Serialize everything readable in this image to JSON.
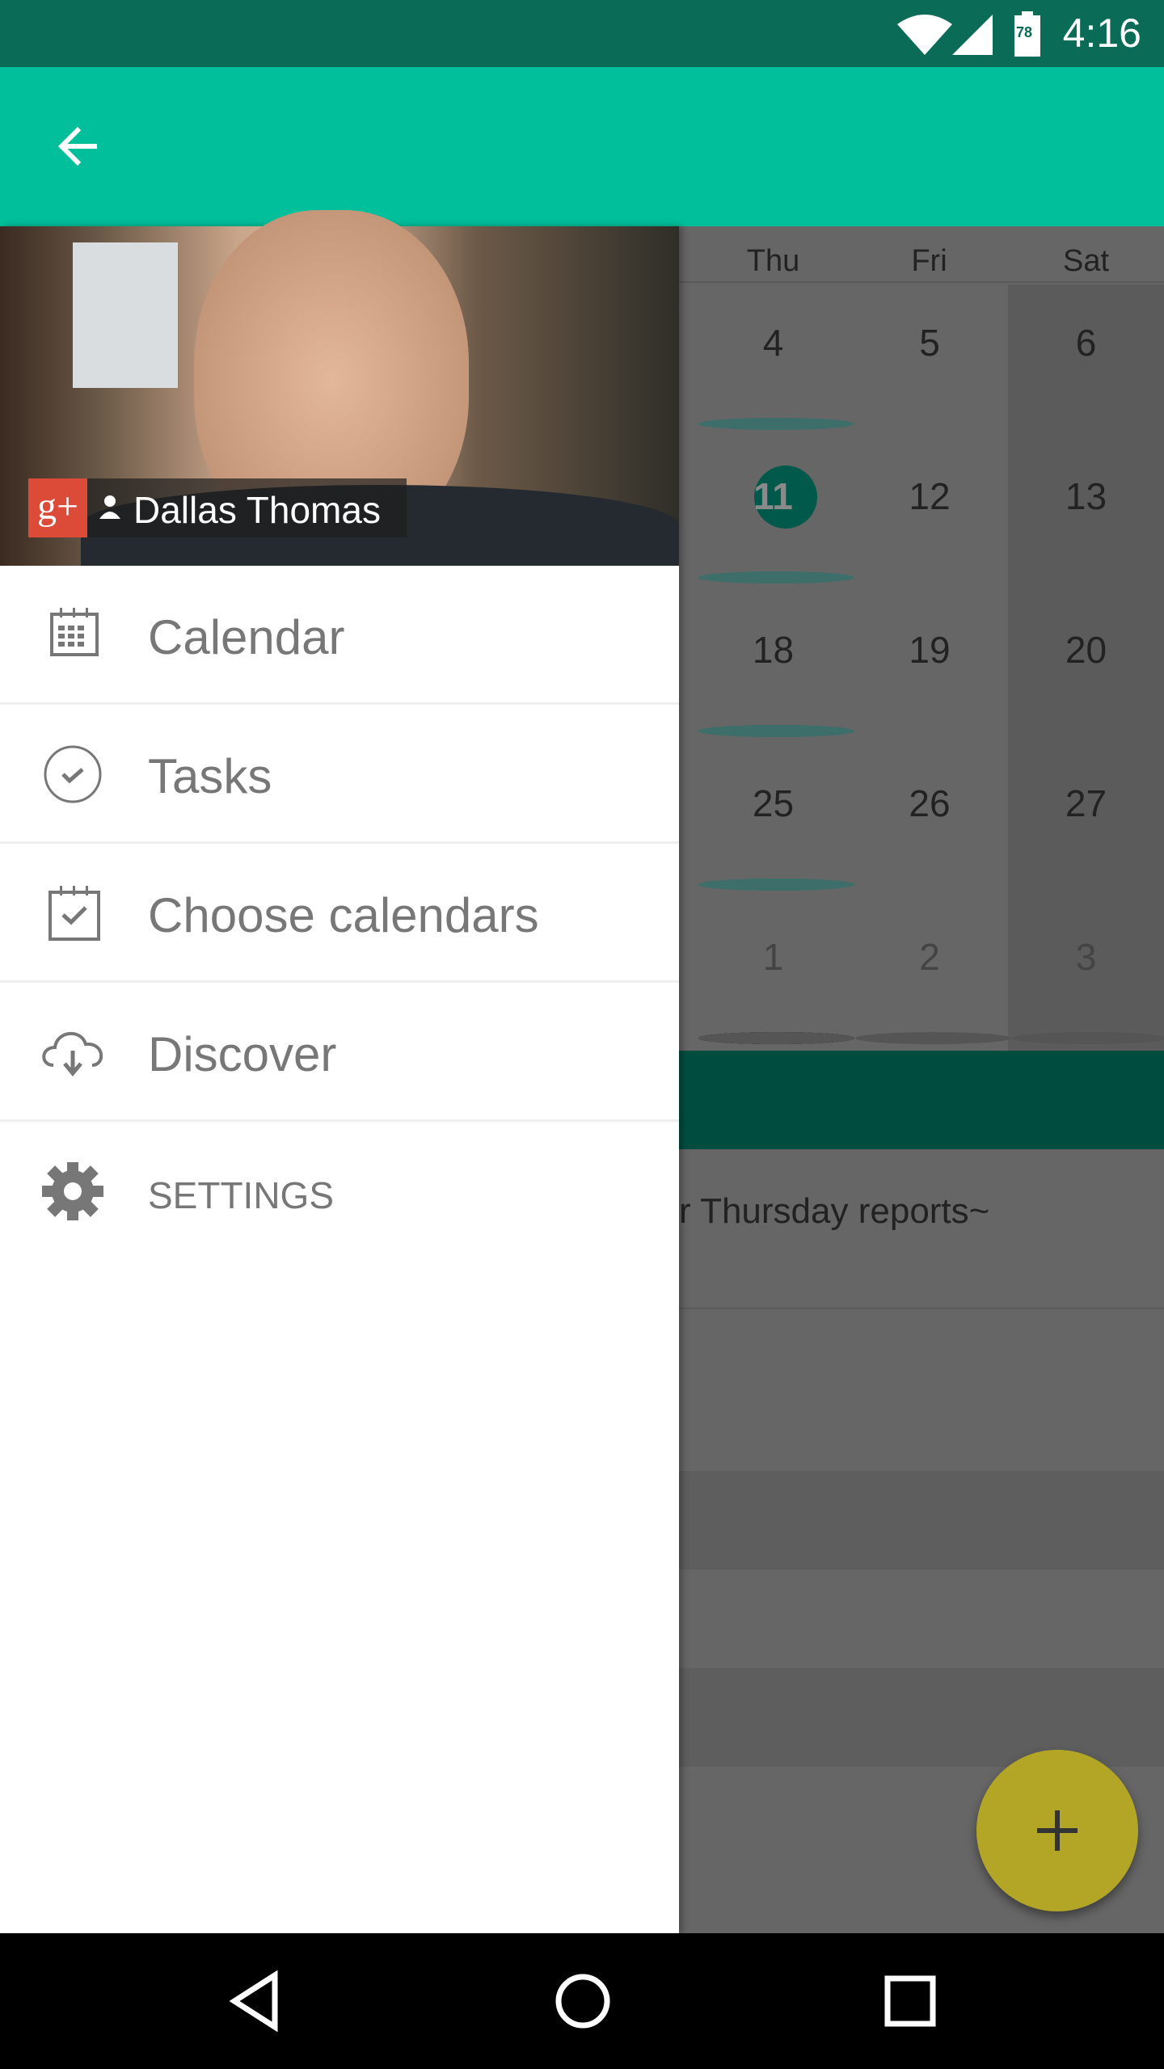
{
  "status_bar": {
    "time": "4:16",
    "battery": "78",
    "icons": [
      "wifi-icon",
      "signal-icon",
      "battery-icon"
    ]
  },
  "app_bar": {
    "back_icon": "arrow-left-icon"
  },
  "drawer": {
    "account": {
      "name": "Dallas Thomas",
      "badge": "g+"
    },
    "items": [
      {
        "label": "Calendar",
        "icon": "calendar-icon"
      },
      {
        "label": "Tasks",
        "icon": "check-circle-icon"
      },
      {
        "label": "Choose calendars",
        "icon": "calendar-check-icon"
      },
      {
        "label": "Discover",
        "icon": "cloud-download-icon"
      },
      {
        "label": "SETTINGS",
        "icon": "gear-icon"
      }
    ]
  },
  "calendar": {
    "days": [
      "Thu",
      "Fri",
      "Sat"
    ],
    "weeks": [
      [
        {
          "d": "4",
          "dots": 2
        },
        {
          "d": "5",
          "dots": 0
        },
        {
          "d": "6",
          "dots": 0
        }
      ],
      [
        {
          "d": "11",
          "dots": 2,
          "today": true
        },
        {
          "d": "12",
          "dots": 0
        },
        {
          "d": "13",
          "dots": 0
        }
      ],
      [
        {
          "d": "18",
          "dots": 3
        },
        {
          "d": "19",
          "dots": 0
        },
        {
          "d": "20",
          "dots": 0
        }
      ],
      [
        {
          "d": "25",
          "dots": 3
        },
        {
          "d": "26",
          "dots": 0
        },
        {
          "d": "27",
          "dots": 0
        }
      ],
      [
        {
          "d": "1",
          "dots": 6,
          "other": true
        },
        {
          "d": "2",
          "dots": 1,
          "other": true
        },
        {
          "d": "3",
          "dots": 1,
          "other": true
        }
      ]
    ],
    "event_text": "r Thursday reports~"
  },
  "fab": {
    "icon": "plus-icon"
  },
  "colors": {
    "primary": "#00bf9a",
    "status": "#0a6b57",
    "today": "#00594b",
    "fab": "#b3a626"
  }
}
